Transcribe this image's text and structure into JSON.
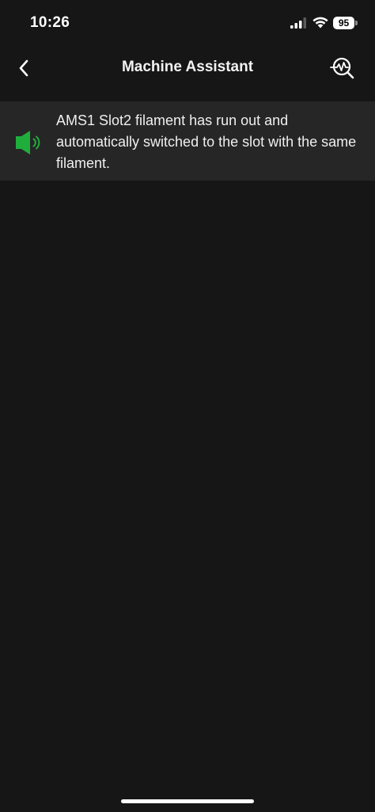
{
  "status_bar": {
    "time": "10:26",
    "battery_level": "95",
    "icons": [
      "cellular-signal-icon",
      "wifi-icon",
      "battery-icon"
    ]
  },
  "header": {
    "title": "Machine Assistant",
    "back_icon": "chevron-left-icon",
    "action_icon": "diagnose-search-icon"
  },
  "messages": [
    {
      "icon": "speaker-icon",
      "text": "AMS1 Slot2 filament has run out and automatically switched to the slot with the same filament."
    }
  ],
  "colors": {
    "background": "#161616",
    "card": "#262626",
    "accent_green": "#1fae3c",
    "text": "#efefef"
  }
}
